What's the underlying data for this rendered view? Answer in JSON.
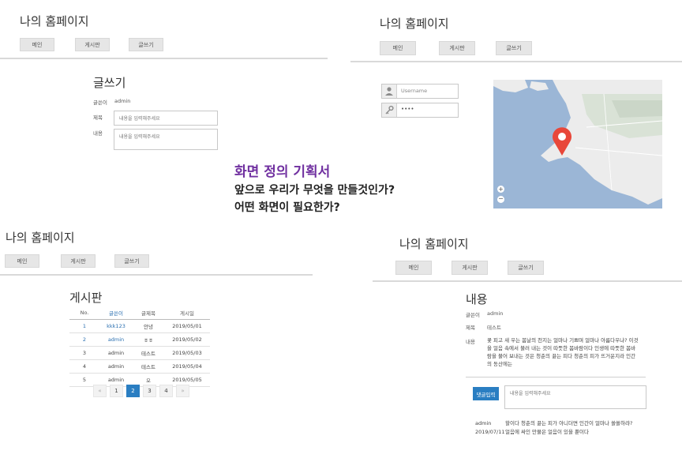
{
  "headline": {
    "title": "화면 정의 기획서",
    "line1": "앞으로 우리가 무엇을 만들것인가?",
    "line2": "어떤 화면이 필요한가?"
  },
  "site": {
    "title": "나의 홈페이지",
    "nav": [
      "메인",
      "게시판",
      "글쓰기"
    ]
  },
  "write_panel": {
    "heading": "글쓰기",
    "author_label": "글쓴이",
    "author_value": "admin",
    "title_label": "제목",
    "title_placeholder": "내용을 입력해주세요",
    "content_label": "내용",
    "content_placeholder": "내용을 입력해주세요"
  },
  "login_panel": {
    "username_placeholder": "Username",
    "password_value": "••••",
    "map_zoom_in": "+",
    "map_zoom_out": "−"
  },
  "board_panel": {
    "heading": "게시판",
    "columns": [
      "No.",
      "글쓴이",
      "글제목",
      "게시일"
    ],
    "rows": [
      [
        "1",
        "kkk123",
        "안녕",
        "2019/05/01"
      ],
      [
        "2",
        "admin",
        "ㅎㅎ",
        "2019/05/02"
      ],
      [
        "3",
        "admin",
        "테스트",
        "2019/05/03"
      ],
      [
        "4",
        "admin",
        "테스트",
        "2019/05/04"
      ],
      [
        "5",
        "admin",
        "오",
        "2019/05/05"
      ]
    ],
    "pagination": [
      "«",
      "1",
      "2",
      "3",
      "4",
      "»"
    ],
    "active_page": "2"
  },
  "view_panel": {
    "heading": "내용",
    "author_label": "글쓴이",
    "author_value": "admin",
    "title_label": "제목",
    "title_value": "테스트",
    "content_label": "내용",
    "content_lines": [
      "꽃 피고 새 우는 봄날의 천지는 얼마나 기쁘며 얼마나 아름다우냐? 이것",
      "을 얼음 속에서 불러 내는 것이 따뜻한 봄바람이다 인생에 따뜻한 봄바",
      "람을 불어 보내는 것은 청춘의 끓는 피다 청춘의 피가 뜨거운지라 인간",
      "의 동산에는"
    ],
    "comment_button": "댓글입력",
    "comment_placeholder": "내용을 입력해주세요",
    "comment_author": "admin",
    "comment_date": "2019/07/11",
    "comment_lines": [
      "할이다 청춘의 끓는 피가 아니더면 인간이 얼마나 쓸쓸하랴?",
      "얼음에 싸인 만물은 얼음이 있을 뿐이다"
    ]
  },
  "colors": {
    "headline_accent": "#7030a0",
    "active_page": "#2a7ec2",
    "map_water": "#9bb6d6",
    "map_land": "#ececec",
    "map_pin": "#e8473a"
  }
}
